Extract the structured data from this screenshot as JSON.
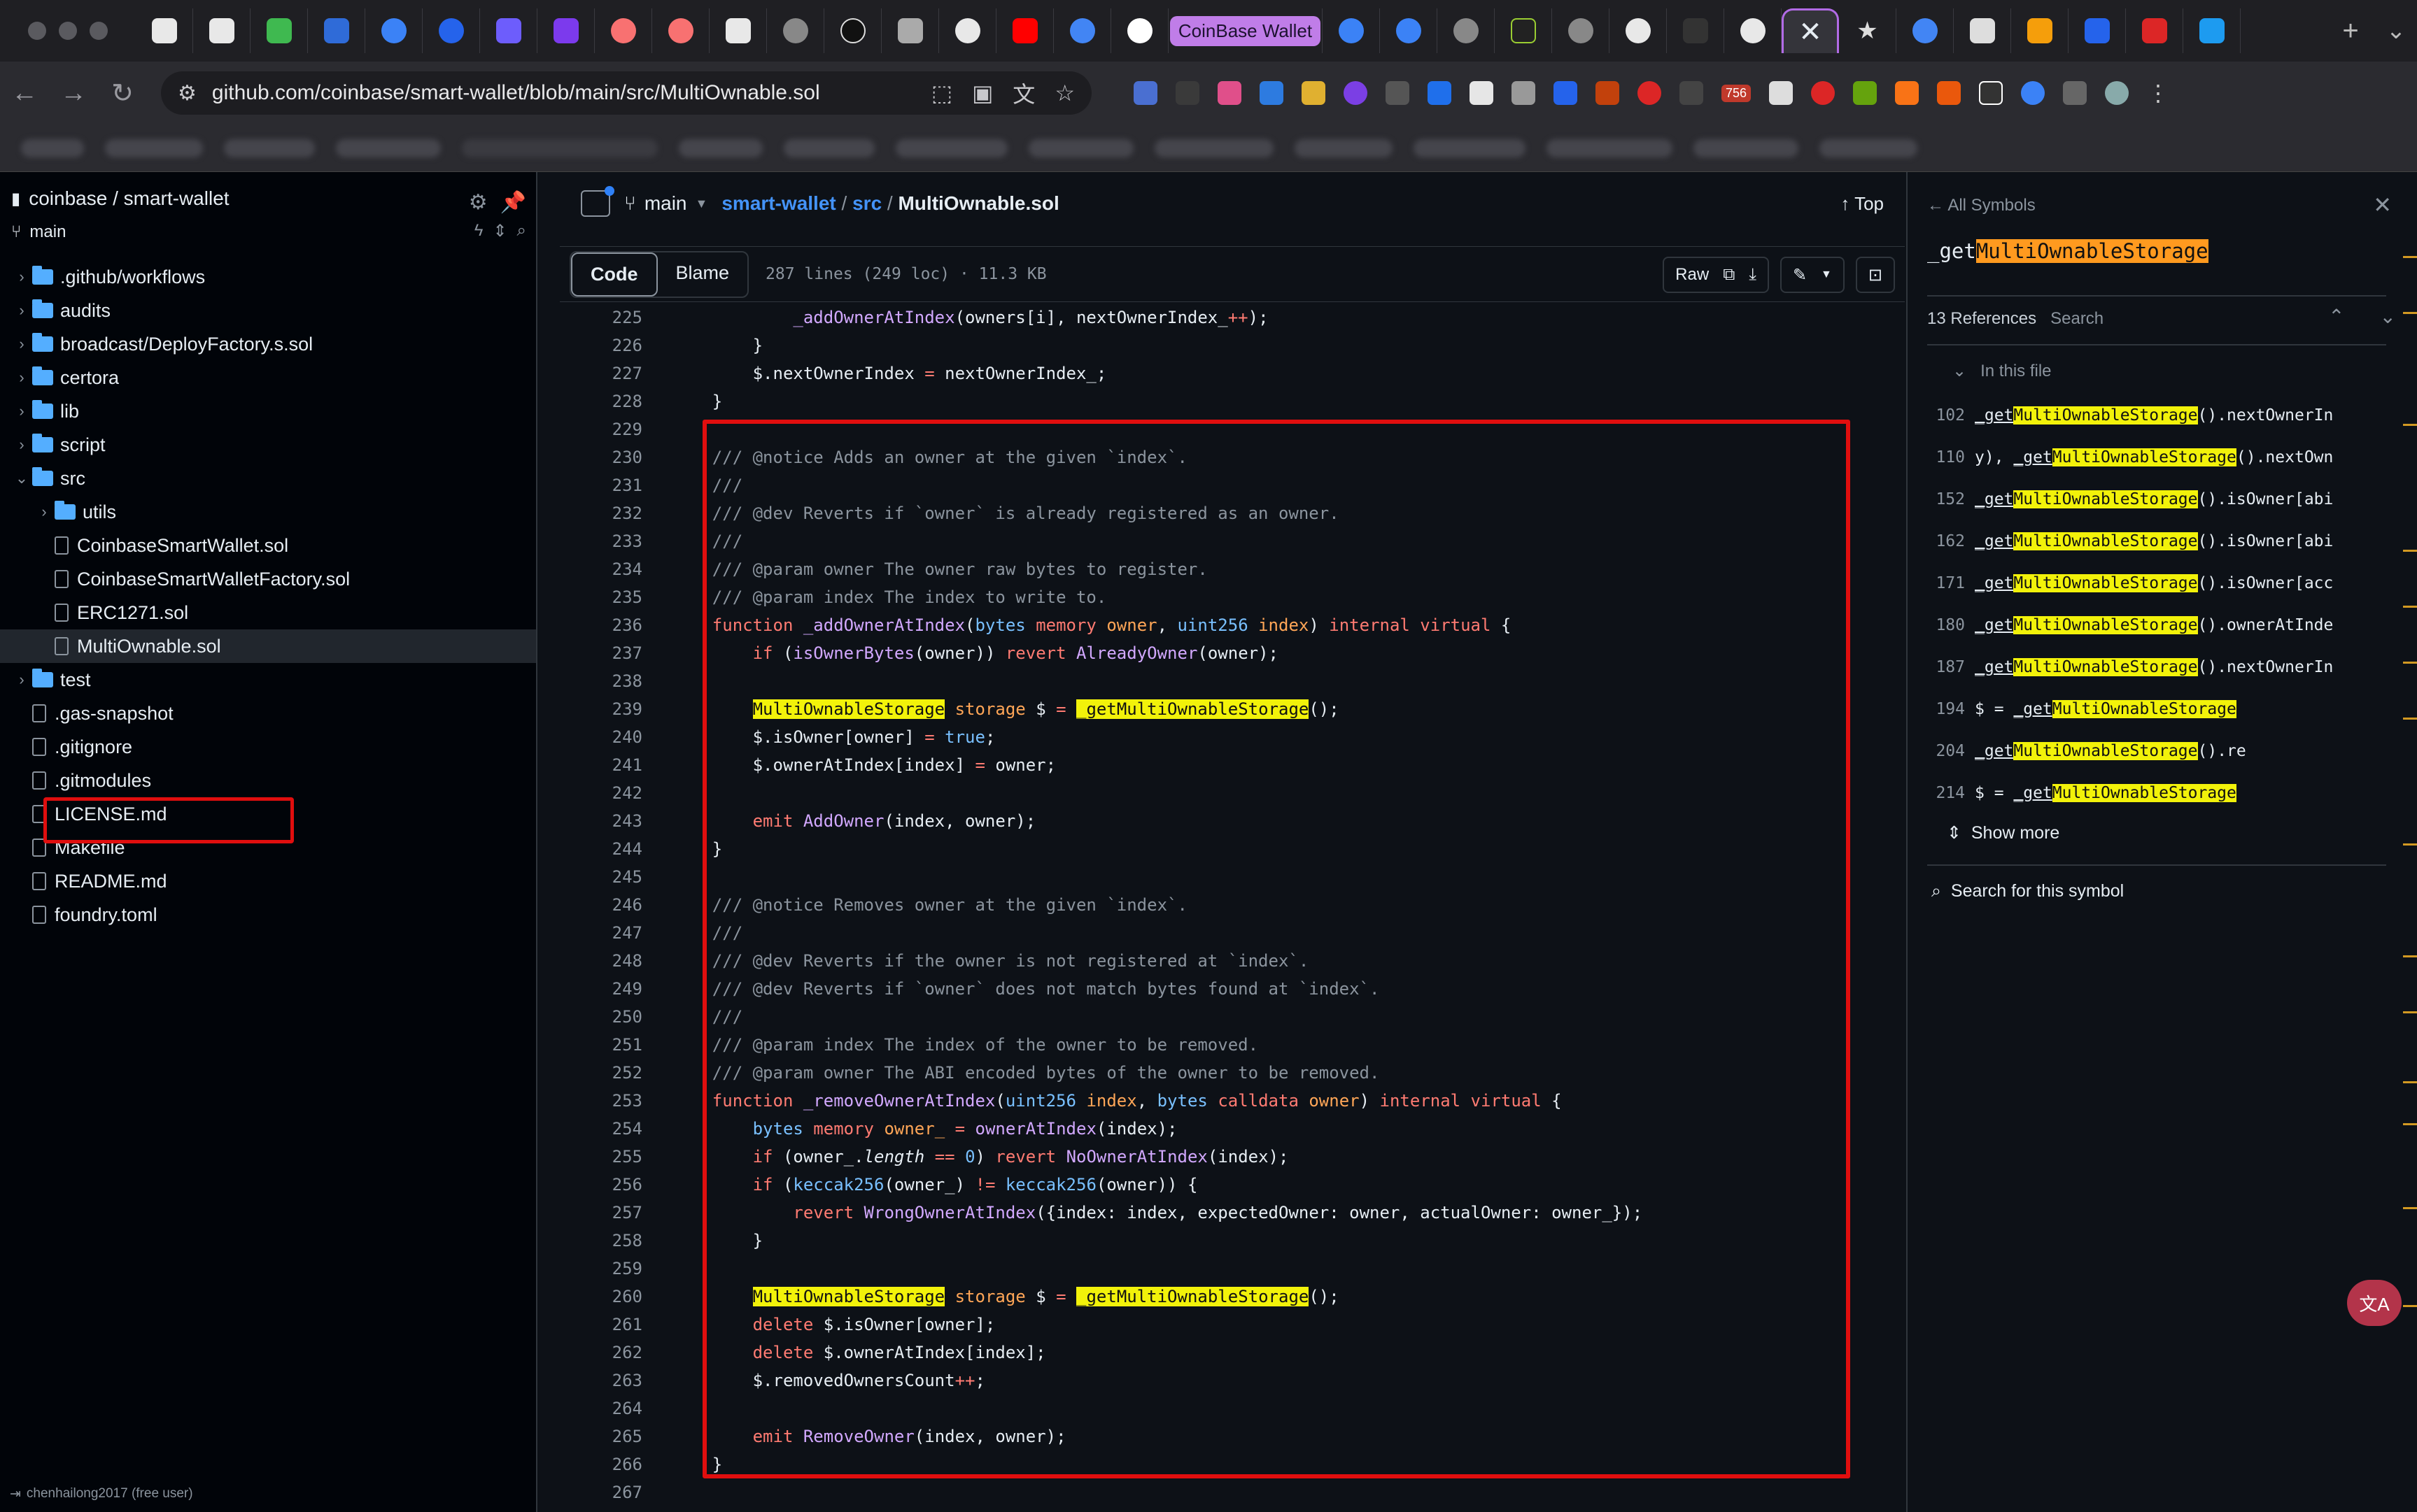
{
  "browser": {
    "tab_text": "CoinBase Wallet",
    "url": "github.com/coinbase/smart-wallet/blob/main/src/MultiOwnable.sol",
    "ext_badge": "756"
  },
  "sidebar": {
    "repo": "coinbase / smart-wallet",
    "branch": "main",
    "user": "chenhailong2017 (free user)",
    "tree": [
      {
        "label": ".github/workflows",
        "kind": "folder",
        "depth": 0
      },
      {
        "label": "audits",
        "kind": "folder",
        "depth": 0
      },
      {
        "label": "broadcast/DeployFactory.s.sol",
        "kind": "folder",
        "depth": 0
      },
      {
        "label": "certora",
        "kind": "folder",
        "depth": 0
      },
      {
        "label": "lib",
        "kind": "folder",
        "depth": 0
      },
      {
        "label": "script",
        "kind": "folder",
        "depth": 0
      },
      {
        "label": "src",
        "kind": "folder-open",
        "depth": 0
      },
      {
        "label": "utils",
        "kind": "folder",
        "depth": 1
      },
      {
        "label": "CoinbaseSmartWallet.sol",
        "kind": "file",
        "depth": 1
      },
      {
        "label": "CoinbaseSmartWalletFactory.sol",
        "kind": "file",
        "depth": 1
      },
      {
        "label": "ERC1271.sol",
        "kind": "file",
        "depth": 1
      },
      {
        "label": "MultiOwnable.sol",
        "kind": "file",
        "depth": 1,
        "selected": true
      },
      {
        "label": "test",
        "kind": "folder",
        "depth": 0
      },
      {
        "label": ".gas-snapshot",
        "kind": "file",
        "depth": 0
      },
      {
        "label": ".gitignore",
        "kind": "file",
        "depth": 0
      },
      {
        "label": ".gitmodules",
        "kind": "file",
        "depth": 0
      },
      {
        "label": "LICENSE.md",
        "kind": "md",
        "depth": 0
      },
      {
        "label": "Makefile",
        "kind": "file",
        "depth": 0
      },
      {
        "label": "README.md",
        "kind": "md",
        "depth": 0
      },
      {
        "label": "foundry.toml",
        "kind": "file",
        "depth": 0
      }
    ]
  },
  "header": {
    "branch": "main",
    "repo_link": "smart-wallet",
    "dir_link": "src",
    "file": "MultiOwnable.sol",
    "top_label": "Top"
  },
  "toolbar": {
    "code_tab": "Code",
    "blame_tab": "Blame",
    "meta": "287 lines (249 loc) · 11.3 KB",
    "raw_label": "Raw"
  },
  "code": [
    {
      "n": "225",
      "html": "            <span class=\"fn\">_addOwnerAtIndex</span>(owners[i], nextOwnerIndex_<span class=\"kw\">++</span>);"
    },
    {
      "n": "226",
      "html": "        }"
    },
    {
      "n": "227",
      "html": "        $.nextOwnerIndex <span class=\"kw\">=</span> nextOwnerIndex_;"
    },
    {
      "n": "228",
      "html": "    }"
    },
    {
      "n": "229",
      "html": ""
    },
    {
      "n": "230",
      "html": "    <span class=\"cm\">/// @notice Adds an owner at the given `index`.</span>"
    },
    {
      "n": "231",
      "html": "    <span class=\"cm\">///</span>"
    },
    {
      "n": "232",
      "html": "    <span class=\"cm\">/// @dev Reverts if `owner` is already registered as an owner.</span>"
    },
    {
      "n": "233",
      "html": "    <span class=\"cm\">///</span>"
    },
    {
      "n": "234",
      "html": "    <span class=\"cm\">/// @param owner The owner raw bytes to register.</span>"
    },
    {
      "n": "235",
      "html": "    <span class=\"cm\">/// @param index The index to write to.</span>"
    },
    {
      "n": "236",
      "html": "    <span class=\"kw\">function</span> <span class=\"fn\">_addOwnerAtIndex</span>(<span class=\"ty\">bytes</span> <span class=\"kw\">memory</span> <span class=\"va\">owner</span>, <span class=\"ty\">uint256</span> <span class=\"va\">index</span>) <span class=\"kw\">internal virtual</span> {"
    },
    {
      "n": "237",
      "html": "        <span class=\"kw\">if</span> (<span class=\"fn\">isOwnerBytes</span>(owner)) <span class=\"kw\">revert</span> <span class=\"fn\">AlreadyOwner</span>(owner);"
    },
    {
      "n": "238",
      "html": ""
    },
    {
      "n": "239",
      "html": "        <span class=\"hl\">MultiOwnableStorage</span> <span class=\"va\">storage</span> $ <span class=\"kw\">=</span> <span class=\"hl\">_get</span><span class=\"hl\">MultiOwnableStorage</span>();"
    },
    {
      "n": "240",
      "html": "        $.isOwner[owner] <span class=\"kw\">=</span> <span class=\"ty\">true</span>;"
    },
    {
      "n": "241",
      "html": "        $.ownerAtIndex[index] <span class=\"kw\">=</span> owner;"
    },
    {
      "n": "242",
      "html": ""
    },
    {
      "n": "243",
      "html": "        <span class=\"kw\">emit</span> <span class=\"fn\">AddOwner</span>(index, owner);"
    },
    {
      "n": "244",
      "html": "    }"
    },
    {
      "n": "245",
      "html": ""
    },
    {
      "n": "246",
      "html": "    <span class=\"cm\">/// @notice Removes owner at the given `index`.</span>"
    },
    {
      "n": "247",
      "html": "    <span class=\"cm\">///</span>"
    },
    {
      "n": "248",
      "html": "    <span class=\"cm\">/// @dev Reverts if the owner is not registered at `index`.</span>"
    },
    {
      "n": "249",
      "html": "    <span class=\"cm\">/// @dev Reverts if `owner` does not match bytes found at `index`.</span>"
    },
    {
      "n": "250",
      "html": "    <span class=\"cm\">///</span>"
    },
    {
      "n": "251",
      "html": "    <span class=\"cm\">/// @param index The index of the owner to be removed.</span>"
    },
    {
      "n": "252",
      "html": "    <span class=\"cm\">/// @param owner The ABI encoded bytes of the owner to be removed.</span>"
    },
    {
      "n": "253",
      "html": "    <span class=\"kw\">function</span> <span class=\"fn\">_removeOwnerAtIndex</span>(<span class=\"ty\">uint256</span> <span class=\"va\">index</span>, <span class=\"ty\">bytes</span> <span class=\"kw\">calldata</span> <span class=\"va\">owner</span>) <span class=\"kw\">internal virtual</span> {"
    },
    {
      "n": "254",
      "html": "        <span class=\"ty\">bytes</span> <span class=\"kw\">memory</span> <span class=\"va\">owner_</span> <span class=\"kw\">=</span> <span class=\"fn\">ownerAtIndex</span>(index);"
    },
    {
      "n": "255",
      "html": "        <span class=\"kw\">if</span> (owner_.<i>length</i> <span class=\"kw\">==</span> <span class=\"ty\">0</span>) <span class=\"kw\">revert</span> <span class=\"fn\">NoOwnerAtIndex</span>(index);"
    },
    {
      "n": "256",
      "html": "        <span class=\"kw\">if</span> (<span class=\"ty\">keccak256</span>(owner_) <span class=\"kw\">!=</span> <span class=\"ty\">keccak256</span>(owner)) {"
    },
    {
      "n": "257",
      "html": "            <span class=\"kw\">revert</span> <span class=\"fn\">WrongOwnerAtIndex</span>({index: index, expectedOwner: owner, actualOwner: owner_});"
    },
    {
      "n": "258",
      "html": "        }"
    },
    {
      "n": "259",
      "html": ""
    },
    {
      "n": "260",
      "html": "        <span class=\"hl\">MultiOwnableStorage</span> <span class=\"va\">storage</span> $ <span class=\"kw\">=</span> <span class=\"hl\">_get</span><span class=\"hl\">MultiOwnableStorage</span>();"
    },
    {
      "n": "261",
      "html": "        <span class=\"kw\">delete</span> $.isOwner[owner];"
    },
    {
      "n": "262",
      "html": "        <span class=\"kw\">delete</span> $.ownerAtIndex[index];"
    },
    {
      "n": "263",
      "html": "        $.removedOwnersCount<span class=\"kw\">++</span>;"
    },
    {
      "n": "264",
      "html": ""
    },
    {
      "n": "265",
      "html": "        <span class=\"kw\">emit</span> <span class=\"fn\">RemoveOwner</span>(index, owner);"
    },
    {
      "n": "266",
      "html": "    }"
    },
    {
      "n": "267",
      "html": ""
    }
  ],
  "symbols": {
    "back_label": "All Symbols",
    "symbol_prefix": "_get",
    "symbol_rest": "MultiOwnableStorage",
    "ref_count": "13 References",
    "search_label": "Search",
    "in_this_file": "In this file",
    "refs": [
      {
        "n": "102",
        "pre": "",
        "post": "().nextOwnerIn"
      },
      {
        "n": "110",
        "pre": "y), ",
        "post": "().nextOwn"
      },
      {
        "n": "152",
        "pre": "",
        "post": "().isOwner[abi"
      },
      {
        "n": "162",
        "pre": "",
        "post": "().isOwner[abi"
      },
      {
        "n": "171",
        "pre": "",
        "post": "().isOwner[acc"
      },
      {
        "n": "180",
        "pre": "",
        "post": "().ownerAtInde"
      },
      {
        "n": "187",
        "pre": "",
        "post": "().nextOwnerIn"
      },
      {
        "n": "194",
        "pre": "$ = ",
        "post": ""
      },
      {
        "n": "204",
        "pre": "",
        "post": "().re"
      },
      {
        "n": "214",
        "pre": "$ = ",
        "post": ""
      }
    ],
    "show_more": "Show more",
    "search_symbol": "Search for this symbol"
  }
}
